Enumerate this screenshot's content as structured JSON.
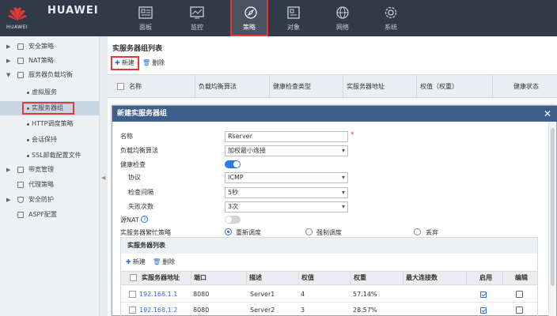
{
  "brand": {
    "main": "HUAWEI",
    "sub": "HUAWEI"
  },
  "nav": [
    {
      "label": "面板",
      "icon": "dashboard-icon"
    },
    {
      "label": "监控",
      "icon": "monitor-icon"
    },
    {
      "label": "策略",
      "icon": "policy-icon",
      "active": true
    },
    {
      "label": "对象",
      "icon": "object-icon"
    },
    {
      "label": "网络",
      "icon": "network-icon"
    },
    {
      "label": "系统",
      "icon": "system-icon"
    }
  ],
  "sidebar": {
    "items": [
      {
        "label": "安全策略"
      },
      {
        "label": "NAT策略"
      },
      {
        "label": "服务器负载均衡"
      },
      {
        "label": "虚拟服务"
      },
      {
        "label": "实服务器组"
      },
      {
        "label": "HTTP调度策略"
      },
      {
        "label": "会话保持"
      },
      {
        "label": "SSL卸载配置文件"
      },
      {
        "label": "带宽管理"
      },
      {
        "label": "代理策略"
      },
      {
        "label": "安全防护"
      },
      {
        "label": "ASPF配置"
      }
    ]
  },
  "main": {
    "title": "实服务器组列表",
    "new_label": "新建",
    "delete_label": "删除",
    "columns": [
      "名称",
      "负载均衡算法",
      "健康检查类型",
      "实服务器地址",
      "权值（权重）",
      "健康状态"
    ]
  },
  "dialog": {
    "title": "新建实服务器组",
    "close": "✕",
    "fields": {
      "name": {
        "label": "名称",
        "value": "Rserver",
        "required": "*"
      },
      "algorithm": {
        "label": "负载均衡算法",
        "value": "加权最小连接"
      },
      "health_check": {
        "label": "健康检查"
      },
      "protocol": {
        "label": "协议",
        "value": "ICMP"
      },
      "interval": {
        "label": "检查间隔",
        "value": "5秒"
      },
      "fail_count": {
        "label": "失败次数",
        "value": "3次"
      },
      "source_nat": {
        "label": "源NAT",
        "help": "?"
      },
      "busy_policy": {
        "label": "实服务器繁忙策略",
        "options": [
          "重新调度",
          "强制调度",
          "丢弃"
        ]
      }
    },
    "server_list": {
      "title": "实服务器列表",
      "new_label": "新建",
      "delete_label": "删除",
      "columns": [
        "实服务器地址",
        "端口",
        "描述",
        "权值",
        "权重",
        "最大连接数",
        "启用",
        "编辑"
      ],
      "rows": [
        {
          "address": "192.168.1.1",
          "port": "8080",
          "desc": "Server1",
          "weight_value": "4",
          "weight": "57.14%",
          "max_conn": ""
        },
        {
          "address": "192.168.1.2",
          "port": "8080",
          "desc": "Server2",
          "weight_value": "3",
          "weight": "28.57%",
          "max_conn": ""
        }
      ]
    }
  }
}
